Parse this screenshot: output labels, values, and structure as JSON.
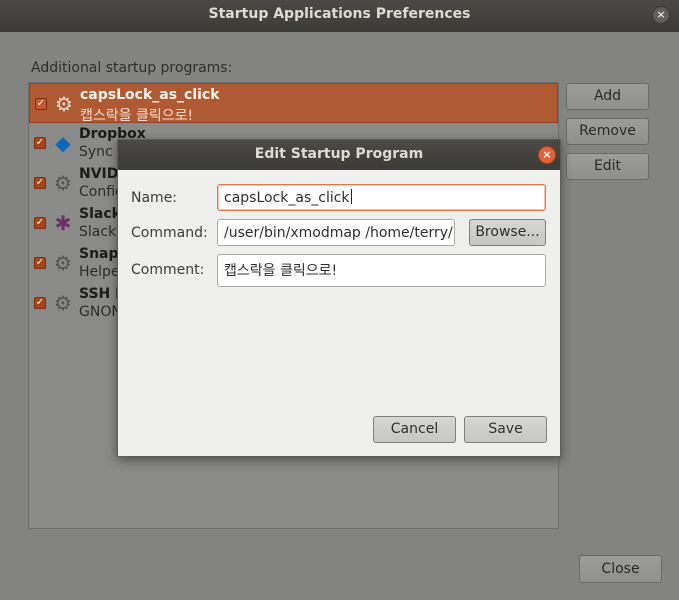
{
  "window": {
    "title": "Startup Applications Preferences",
    "close_glyph": "×",
    "section_label": "Additional startup programs:",
    "buttons": {
      "add": "Add",
      "remove": "Remove",
      "edit": "Edit",
      "close": "Close"
    },
    "programs": [
      {
        "name": "capsLock_as_click",
        "desc": "캡스락을 클릭으로!",
        "checked": true,
        "selected": true,
        "icon": "gear-icon"
      },
      {
        "name": "Dropbox",
        "desc": "Sync y",
        "checked": true,
        "selected": false,
        "icon": "dropbox-icon"
      },
      {
        "name": "NVID",
        "desc": "Config",
        "checked": true,
        "selected": false,
        "icon": "gear-icon"
      },
      {
        "name": "Slack",
        "desc": "Slack",
        "checked": true,
        "selected": false,
        "icon": "slack-icon"
      },
      {
        "name": "Snap",
        "desc": "Helpe",
        "checked": true,
        "selected": false,
        "icon": "gear-icon"
      },
      {
        "name": "SSH K",
        "desc": "GNON",
        "checked": true,
        "selected": false,
        "icon": "gear-icon"
      }
    ]
  },
  "dialog": {
    "title": "Edit Startup Program",
    "close_glyph": "×",
    "labels": {
      "name": "Name:",
      "command": "Command:",
      "comment": "Comment:"
    },
    "values": {
      "name": "capsLock_as_click",
      "command": "/user/bin/xmodmap /home/terry/",
      "comment": "캡스락을 클릭으로!"
    },
    "browse_label": "Browse...",
    "cancel_label": "Cancel",
    "save_label": "Save"
  },
  "colors": {
    "accent": "#e0633a",
    "selection": "#b05a33"
  }
}
